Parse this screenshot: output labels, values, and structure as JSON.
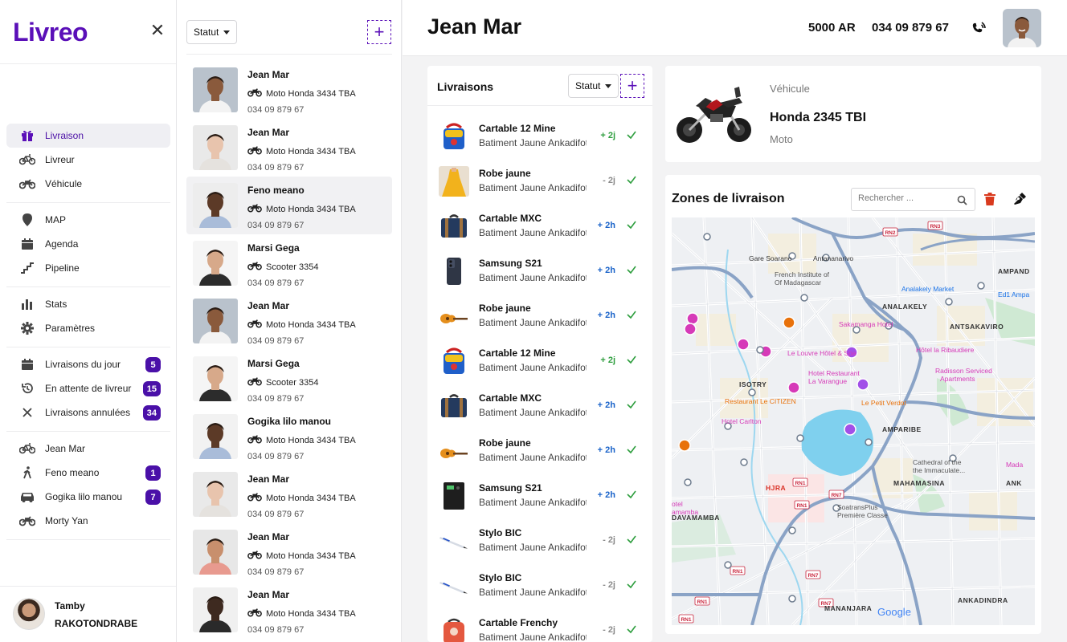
{
  "app": {
    "logo": "Livreo",
    "close_glyph": "✕"
  },
  "sidebar": {
    "groups": [
      [
        {
          "label": "Livraison",
          "icon": "gift-icon",
          "active": true
        },
        {
          "label": "Livreur",
          "icon": "bicycle-icon"
        },
        {
          "label": "Véhicule",
          "icon": "motorbike-icon"
        }
      ],
      [
        {
          "label": "MAP",
          "icon": "map-pin-icon"
        },
        {
          "label": "Agenda",
          "icon": "calendar-icon"
        },
        {
          "label": "Pipeline",
          "icon": "pipeline-icon"
        }
      ],
      [
        {
          "label": "Stats",
          "icon": "bar-chart-icon"
        },
        {
          "label": "Paramètres",
          "icon": "gear-icon"
        }
      ],
      [
        {
          "label": "Livraisons du jour",
          "icon": "calendar-icon",
          "badge": "5"
        },
        {
          "label": "En attente de livreur",
          "icon": "history-icon",
          "badge": "15"
        },
        {
          "label": "Livraisons annulées",
          "icon": "close-icon",
          "badge": "34"
        }
      ],
      [
        {
          "label": "Jean Mar",
          "icon": "bicycle-icon"
        },
        {
          "label": "Feno meano",
          "icon": "walking-icon",
          "badge": "1"
        },
        {
          "label": "Gogika lilo manou",
          "icon": "car-icon",
          "badge": "7"
        },
        {
          "label": "Morty Yan",
          "icon": "motorbike-icon"
        }
      ]
    ],
    "user": {
      "first": "Tamby",
      "last": "RAKOTONDRABE"
    }
  },
  "drivers_panel": {
    "filter_label": "Statut",
    "add_glyph": "+",
    "drivers": [
      {
        "name": "Jean Mar",
        "vehicle": "Moto Honda 3434 TBA",
        "phone": "034 09 879 67",
        "skin": "#8a5a3c",
        "bg": "#b9c2cc",
        "shirt": "#f3f3f3",
        "highlight": false
      },
      {
        "name": "Jean Mar",
        "vehicle": "Moto Honda 3434 TBA",
        "phone": "034 09 879 67",
        "skin": "#e8c4ad",
        "bg": "#e9e9e9",
        "shirt": "#e5e2de",
        "highlight": false
      },
      {
        "name": "Feno meano",
        "vehicle": "Moto Honda 3434 TBA",
        "phone": "034 09 879 67",
        "skin": "#5c3a27",
        "bg": "#ededed",
        "shirt": "#a9bcd9",
        "highlight": true
      },
      {
        "name": "Marsi Gega",
        "vehicle": "Scooter 3354",
        "phone": "034 09 879 67",
        "skin": "#d7a98a",
        "bg": "#f5f5f5",
        "shirt": "#2c2c2c",
        "highlight": false
      },
      {
        "name": "Jean Mar",
        "vehicle": "Moto Honda 3434 TBA",
        "phone": "034 09 879 67",
        "skin": "#8a5a3c",
        "bg": "#b9c2cc",
        "shirt": "#f3f3f3",
        "highlight": false
      },
      {
        "name": "Marsi Gega",
        "vehicle": "Scooter 3354",
        "phone": "034 09 879 67",
        "skin": "#d7a98a",
        "bg": "#f5f5f5",
        "shirt": "#2c2c2c",
        "highlight": false
      },
      {
        "name": "Gogika lilo manou",
        "vehicle": "Moto Honda 3434 TBA",
        "phone": "034 09 879 67",
        "skin": "#5c3a27",
        "bg": "#f2f2f2",
        "shirt": "#a9bcd9",
        "highlight": false
      },
      {
        "name": "Jean Mar",
        "vehicle": "Moto Honda 3434 TBA",
        "phone": "034 09 879 67",
        "skin": "#e8c4ad",
        "bg": "#e9e9e9",
        "shirt": "#e5e2de",
        "highlight": false
      },
      {
        "name": "Jean Mar",
        "vehicle": "Moto Honda 3434 TBA",
        "phone": "034 09 879 67",
        "skin": "#c88f6d",
        "bg": "#e7e7e7",
        "shirt": "#e89a8f",
        "highlight": false
      },
      {
        "name": "Jean Mar",
        "vehicle": "Moto Honda 3434 TBA",
        "phone": "034 09 879 67",
        "skin": "#3e2a20",
        "bg": "#f0f0f0",
        "shirt": "#2a2a2a",
        "highlight": false
      }
    ]
  },
  "header": {
    "title": "Jean Mar",
    "amount": "5000 AR",
    "phone": "034 09 879 67"
  },
  "deliveries": {
    "title": "Livraisons",
    "filter_label": "Statut",
    "add_glyph": "+",
    "items": [
      {
        "name": "Cartable 12 Mine",
        "address": "Batiment Jaune Ankadifotsy",
        "time": "+ 2j",
        "kind": "green",
        "thumb": "bag-blue"
      },
      {
        "name": "Robe jaune",
        "address": "Batiment Jaune Ankadifotsy",
        "time": "- 2j",
        "kind": "grey",
        "thumb": "dress"
      },
      {
        "name": "Cartable MXC",
        "address": "Batiment Jaune Ankadifotsy",
        "time": "+ 2h",
        "kind": "blue",
        "thumb": "bag-navy"
      },
      {
        "name": "Samsung S21",
        "address": "Batiment Jaune Ankadifotsy",
        "time": "+ 2h",
        "kind": "blue",
        "thumb": "phone"
      },
      {
        "name": "Robe jaune",
        "address": "Batiment Jaune Ankadifotsy",
        "time": "+ 2h",
        "kind": "blue",
        "thumb": "guitar"
      },
      {
        "name": "Cartable 12 Mine",
        "address": "Batiment Jaune Ankadifotsy",
        "time": "+ 2j",
        "kind": "green",
        "thumb": "bag-blue"
      },
      {
        "name": "Cartable MXC",
        "address": "Batiment Jaune Ankadifotsy",
        "time": "+ 2h",
        "kind": "blue",
        "thumb": "bag-navy"
      },
      {
        "name": "Robe jaune",
        "address": "Batiment Jaune Ankadifotsy",
        "time": "+ 2h",
        "kind": "blue",
        "thumb": "guitar"
      },
      {
        "name": "Samsung S21",
        "address": "Batiment Jaune Ankadifotsy",
        "time": "+ 2h",
        "kind": "blue",
        "thumb": "ups"
      },
      {
        "name": "Stylo BIC",
        "address": "Batiment Jaune Ankadifotsy",
        "time": "- 2j",
        "kind": "grey",
        "thumb": "pen"
      },
      {
        "name": "Stylo BIC",
        "address": "Batiment Jaune Ankadifotsy",
        "time": "- 2j",
        "kind": "grey",
        "thumb": "pen"
      },
      {
        "name": "Cartable Frenchy",
        "address": "Batiment Jaune Ankadifotsy",
        "time": "- 2j",
        "kind": "grey",
        "thumb": "bag-red"
      }
    ]
  },
  "vehicle": {
    "label": "Véhicule",
    "name": "Honda 2345 TBI",
    "type": "Moto"
  },
  "zones": {
    "title": "Zones de livraison",
    "search_placeholder": "Rechercher ..."
  },
  "map": {
    "labels": [
      {
        "text": "Gare Soarano",
        "color": "#333"
      },
      {
        "text": "Antananarivo",
        "color": "#333"
      },
      {
        "text": "French Institute of",
        "color": "#555"
      },
      {
        "text": "Of Madagascar",
        "color": "#555"
      },
      {
        "text": "Analakely Market",
        "color": "#1a73e8"
      },
      {
        "text": "AMPAND",
        "color": "#333"
      },
      {
        "text": "Ed1 Ampa",
        "color": "#1a73e8"
      },
      {
        "text": "ANALAKELY",
        "color": "#333"
      },
      {
        "text": "ANTSAKAVIRO",
        "color": "#333"
      },
      {
        "text": "Sakamanga Hotel",
        "color": "#d63ab8"
      },
      {
        "text": "Le Louvre Hôtel & Spa",
        "color": "#d63ab8"
      },
      {
        "text": "Hôtel la Ribaudiere",
        "color": "#d63ab8"
      },
      {
        "text": "Hotel Restaurant",
        "color": "#d63ab8"
      },
      {
        "text": "La Varangue",
        "color": "#d63ab8"
      },
      {
        "text": "Radisson Serviced",
        "color": "#d63ab8"
      },
      {
        "text": "Apartments",
        "color": "#d63ab8"
      },
      {
        "text": "ISOTRY",
        "color": "#333"
      },
      {
        "text": "Restaurant Le CITIZEN",
        "color": "#e8710a"
      },
      {
        "text": "Le Petit Verdot",
        "color": "#e8710a"
      },
      {
        "text": "Hotel Carlton",
        "color": "#d63ab8"
      },
      {
        "text": "AMPARIBE",
        "color": "#333"
      },
      {
        "text": "Cathedral of the",
        "color": "#555"
      },
      {
        "text": "the Immaculate...",
        "color": "#555"
      },
      {
        "text": "Mada",
        "color": "#d63ab8"
      },
      {
        "text": "ANK",
        "color": "#333"
      },
      {
        "text": "HJRA",
        "color": "#d93025"
      },
      {
        "text": "MAHAMASINA",
        "color": "#333"
      },
      {
        "text": "SoatransPlus",
        "color": "#555"
      },
      {
        "text": "Première Classe",
        "color": "#555"
      },
      {
        "text": "DAVAMAMBA",
        "color": "#333"
      },
      {
        "text": "otel",
        "color": "#d63ab8"
      },
      {
        "text": "amamba",
        "color": "#d63ab8"
      },
      {
        "text": "MANANJARA",
        "color": "#333"
      },
      {
        "text": "ANKADINDRA",
        "color": "#333"
      },
      {
        "text": "Google",
        "color": "#4285f4"
      }
    ],
    "road_shields": [
      "RN2",
      "RN3",
      "RN1",
      "RN7",
      "RN1",
      "RN1",
      "RN7",
      "RN7",
      "RN1",
      "RN1"
    ]
  }
}
